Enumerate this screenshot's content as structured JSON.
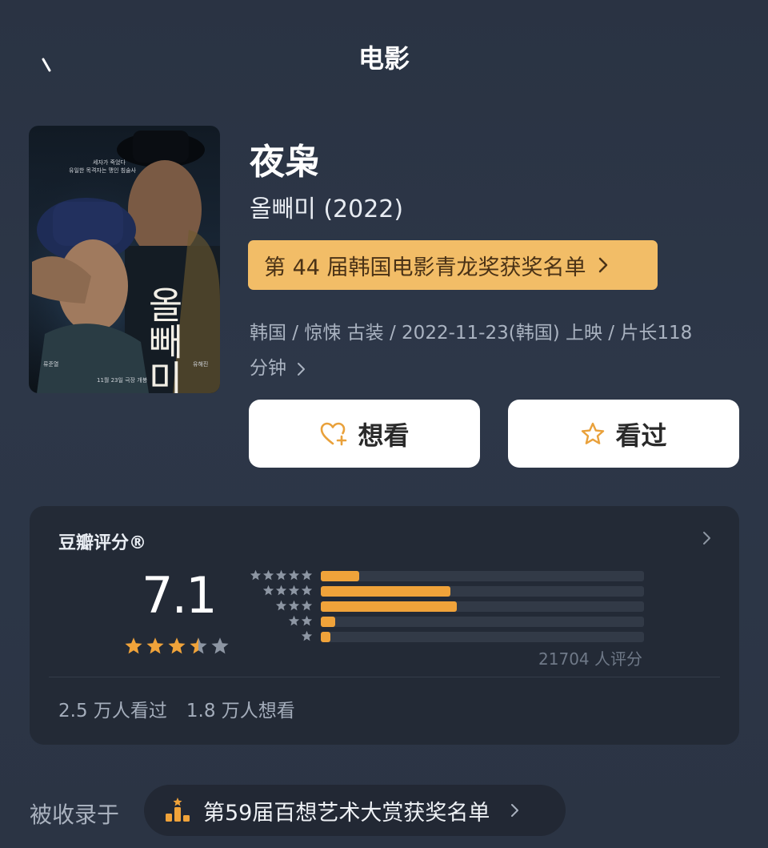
{
  "header": {
    "title": "电影",
    "back_icon": "back-icon"
  },
  "movie": {
    "title": "夜枭",
    "original_title": "올빼미 (2022)",
    "list_banner": "第 44 届韩国电影青龙奖获奖名单",
    "meta_line1": "韩国 / 惊悚 古装 / 2022-11-23(韩国) 上映 / 片长118",
    "meta_line2": "分钟",
    "poster": {
      "korean_title": "올빼미",
      "tagline_line1": "세자가 죽었다",
      "tagline_line2": "유일한 목격자는 맹인 침술사",
      "release_note": "11월 23일 극장 개봉",
      "actor_left": "류준열",
      "actor_right": "유해진"
    }
  },
  "actions": {
    "want_label": "想看",
    "seen_label": "看过"
  },
  "rating": {
    "label": "豆瓣评分®",
    "score": "7.1",
    "score_stars": 3.5,
    "distribution": [
      {
        "stars": 5,
        "fraction": 0.12
      },
      {
        "stars": 4,
        "fraction": 0.4
      },
      {
        "stars": 3,
        "fraction": 0.42
      },
      {
        "stars": 2,
        "fraction": 0.045
      },
      {
        "stars": 1,
        "fraction": 0.03
      }
    ],
    "count_text": "21704 人评分",
    "watched_text": "2.5 万人看过",
    "want_text": "1.8 万人想看"
  },
  "collection": {
    "label": "被收录于",
    "item": "第59届百想艺术大赏获奖名单"
  },
  "colors": {
    "accent": "#f0a33a",
    "banner": "#f2bd67",
    "card": "#232a36",
    "bar_track": "#323a47",
    "star_empty": "#8d96a3"
  }
}
